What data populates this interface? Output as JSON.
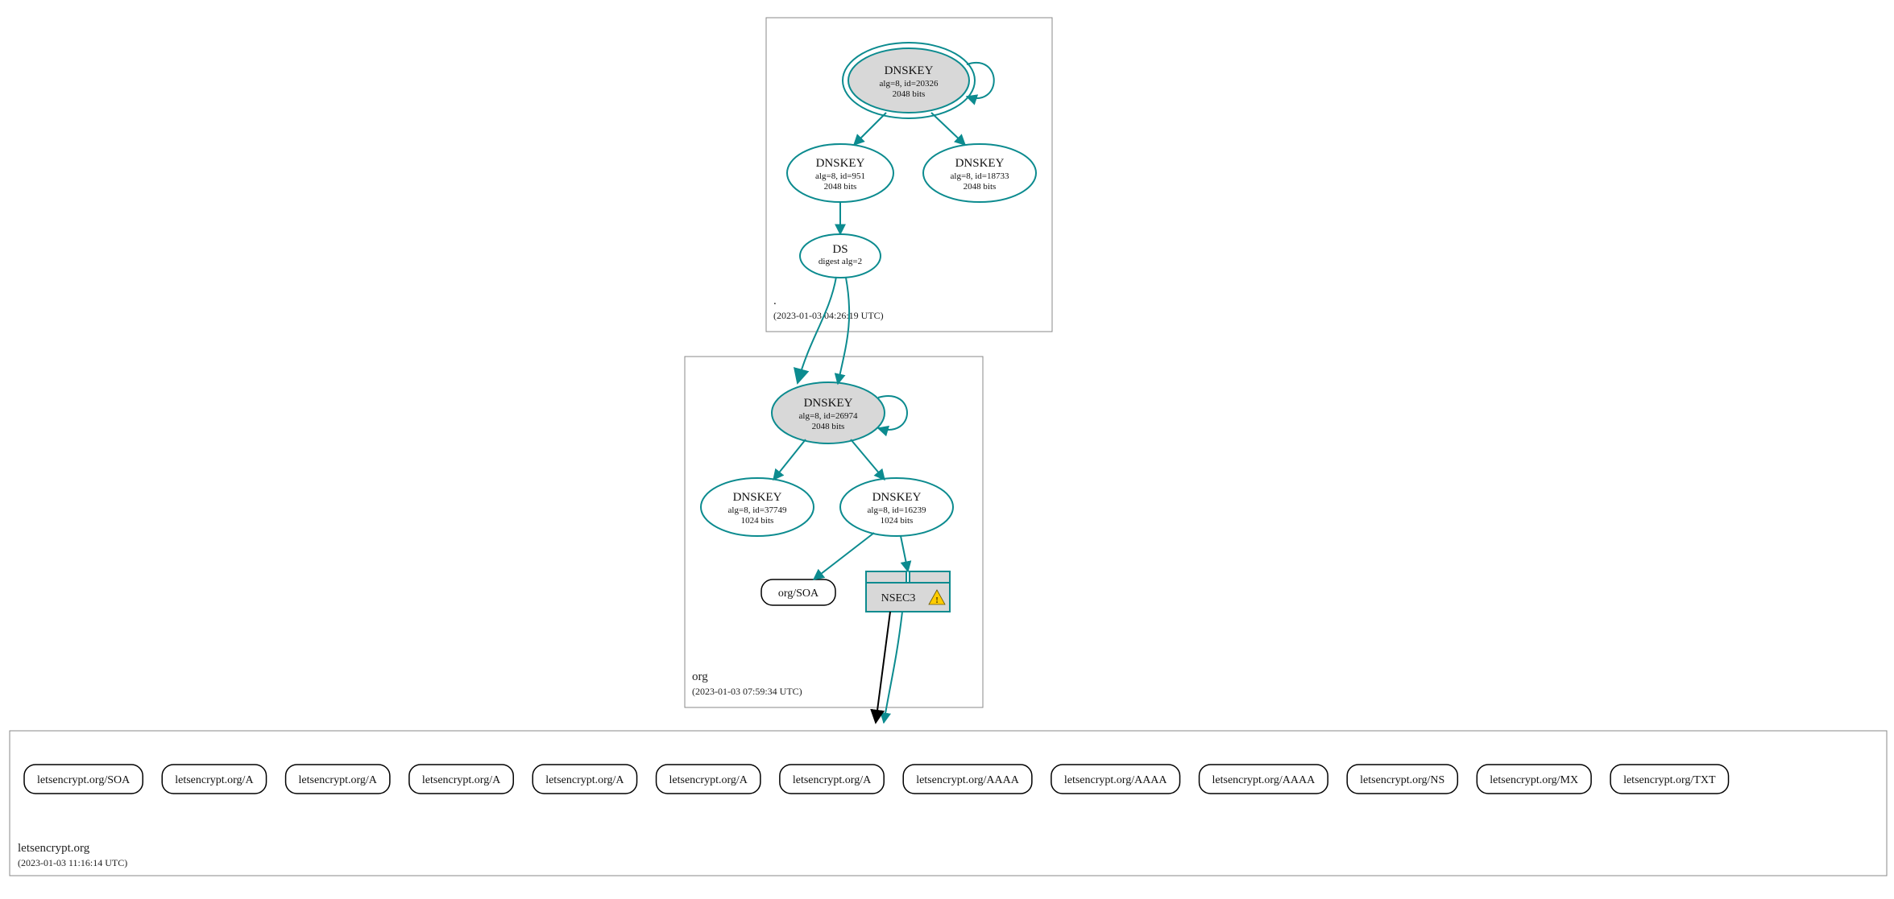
{
  "colors": {
    "teal": "#0c8b8f",
    "grey": "#d8d8d8",
    "border": "#888888"
  },
  "root_zone": {
    "label": ".",
    "timestamp": "(2023-01-03 04:26:19 UTC)",
    "ksk": {
      "title": "DNSKEY",
      "detail1": "alg=8, id=20326",
      "detail2": "2048 bits"
    },
    "zsk1": {
      "title": "DNSKEY",
      "detail1": "alg=8, id=951",
      "detail2": "2048 bits"
    },
    "zsk2": {
      "title": "DNSKEY",
      "detail1": "alg=8, id=18733",
      "detail2": "2048 bits"
    },
    "ds": {
      "title": "DS",
      "detail1": "digest alg=2"
    }
  },
  "org_zone": {
    "label": "org",
    "timestamp": "(2023-01-03 07:59:34 UTC)",
    "ksk": {
      "title": "DNSKEY",
      "detail1": "alg=8, id=26974",
      "detail2": "2048 bits"
    },
    "zsk1": {
      "title": "DNSKEY",
      "detail1": "alg=8, id=37749",
      "detail2": "1024 bits"
    },
    "zsk2": {
      "title": "DNSKEY",
      "detail1": "alg=8, id=16239",
      "detail2": "1024 bits"
    },
    "soa": {
      "title": "org/SOA"
    },
    "nsec3": {
      "title": "NSEC3"
    }
  },
  "target_zone": {
    "label": "letsencrypt.org",
    "timestamp": "(2023-01-03 11:16:14 UTC)",
    "records": [
      "letsencrypt.org/SOA",
      "letsencrypt.org/A",
      "letsencrypt.org/A",
      "letsencrypt.org/A",
      "letsencrypt.org/A",
      "letsencrypt.org/A",
      "letsencrypt.org/A",
      "letsencrypt.org/AAAA",
      "letsencrypt.org/AAAA",
      "letsencrypt.org/AAAA",
      "letsencrypt.org/NS",
      "letsencrypt.org/MX",
      "letsencrypt.org/TXT"
    ]
  }
}
